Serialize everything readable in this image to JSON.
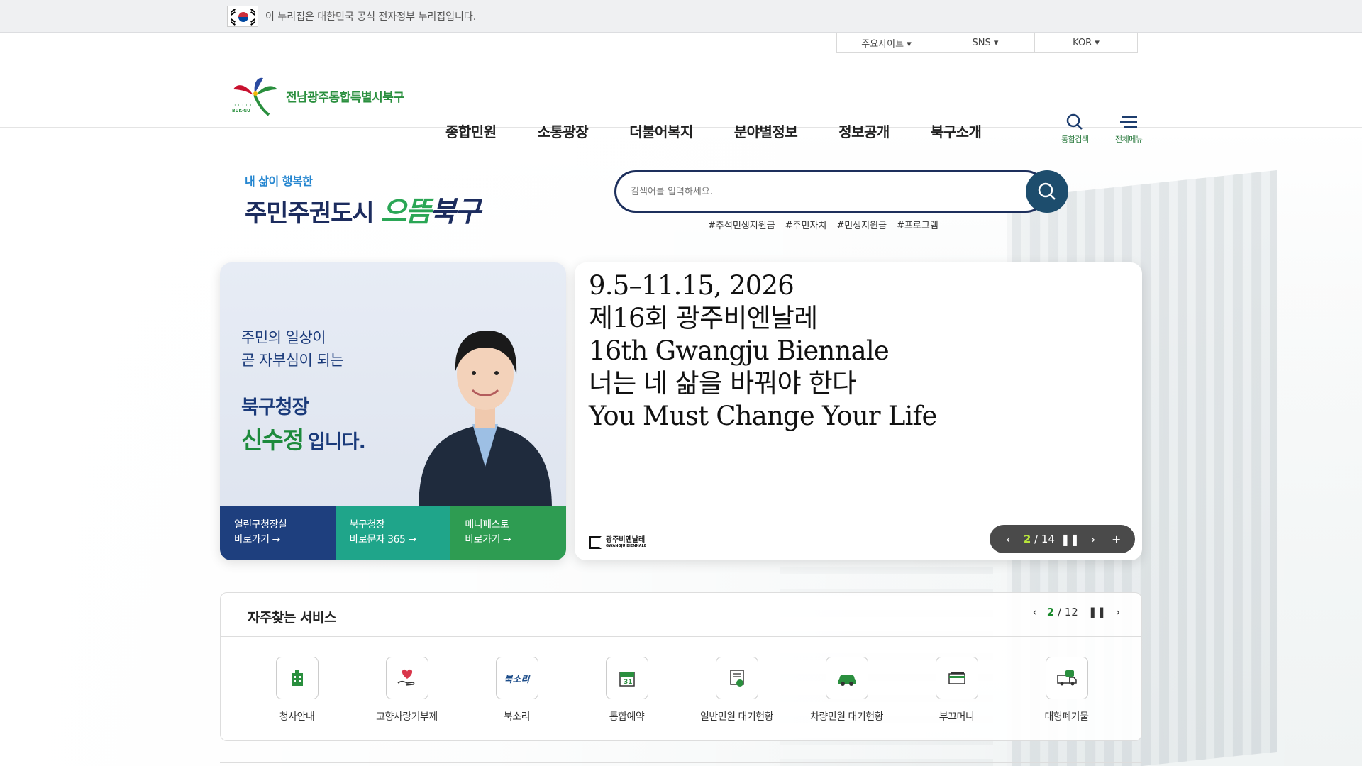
{
  "gov_banner": {
    "text": "이 누리집은 대한민국 공식 전자정부 누리집입니다."
  },
  "utility": {
    "items": [
      "주요사이트 ▾",
      "SNS ▾",
      "KOR ▾"
    ]
  },
  "logo": {
    "text": "전남광주통합특별시북구"
  },
  "gnb": {
    "menus": [
      "종합민원",
      "소통광장",
      "더불어복지",
      "분야별정보",
      "정보공개",
      "북구소개"
    ]
  },
  "tools": {
    "search_label": "통합검색",
    "menu_label": "전체메뉴"
  },
  "slogan": {
    "line1": "내 삶이 행복한",
    "line2": "주민주권도시",
    "accent_green": "으뜸",
    "accent_navy": "북구"
  },
  "search": {
    "placeholder": "검색어를 입력하세요.",
    "tags": [
      "#추석민생지원금",
      "#주민자치",
      "#민생지원금",
      "#프로그램"
    ]
  },
  "left_card": {
    "line1": "주민의 일상이",
    "line2": "곧 자부심이 되는",
    "title": "북구청장",
    "name": "신수정",
    "name_suffix": "입니다.",
    "quick_links": [
      {
        "l1": "열린구청장실",
        "l2": "바로가기 →"
      },
      {
        "l1": "북구청장",
        "l2": "바로문자 365 →"
      },
      {
        "l1": "매니페스토",
        "l2": "바로가기 →"
      }
    ]
  },
  "right_card": {
    "lines": [
      "9.5–11.15, 2026",
      "제16회 광주비엔날레",
      "16th Gwangju Biennale",
      "너는 네 삶을 바꿔야 한다",
      "You Must Change Your Life"
    ],
    "logo_text": "광주비엔날레",
    "logo_sub": "GWANGJU BIENNALE",
    "current": "2",
    "total": "14"
  },
  "services": {
    "title": "자주찾는 서비스",
    "current": "2",
    "total": "12",
    "items": [
      {
        "label": "청사안내",
        "icon": "building-icon"
      },
      {
        "label": "고향사랑기부제",
        "icon": "heart-hand-icon"
      },
      {
        "label": "북소리",
        "icon": "buksori-icon",
        "icon_text": "북소리"
      },
      {
        "label": "통합예약",
        "icon": "calendar-icon",
        "icon_text": "31"
      },
      {
        "label": "일반민원 대기현황",
        "icon": "document-icon"
      },
      {
        "label": "차량민원 대기현황",
        "icon": "car-icon"
      },
      {
        "label": "부끄머니",
        "icon": "card-icon"
      },
      {
        "label": "대형폐기물",
        "icon": "truck-icon"
      }
    ]
  },
  "colors": {
    "navy": "#1c2c5e",
    "green": "#2aa655",
    "blue": "#2586d0",
    "accent_lime": "#b7e43a"
  }
}
